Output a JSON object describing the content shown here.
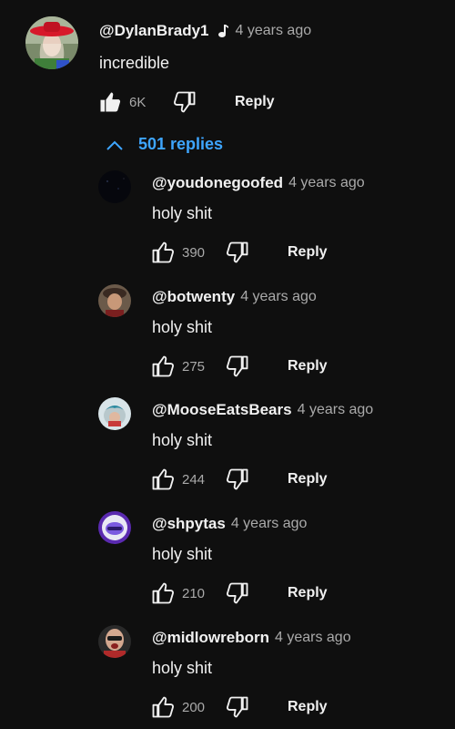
{
  "top_comment": {
    "author": "@DylanBrady1",
    "badge_icon": "music-note-icon",
    "time": "4 years ago",
    "text": "incredible",
    "like_count": "6K",
    "reply_label": "Reply"
  },
  "replies_toggle": {
    "icon": "chevron-up-icon",
    "label": "501 replies"
  },
  "replies": [
    {
      "author": "@youdonegoofed",
      "time": "4 years ago",
      "text": "holy shit",
      "like_count": "390",
      "reply_label": "Reply"
    },
    {
      "author": "@botwenty",
      "time": "4 years ago",
      "text": "holy shit",
      "like_count": "275",
      "reply_label": "Reply"
    },
    {
      "author": "@MooseEatsBears",
      "time": "4 years ago",
      "text": "holy shit",
      "like_count": "244",
      "reply_label": "Reply"
    },
    {
      "author": "@shpytas",
      "time": "4 years ago",
      "text": "holy shit",
      "like_count": "210",
      "reply_label": "Reply"
    },
    {
      "author": "@midlowreborn",
      "time": "4 years ago",
      "text": "holy shit",
      "like_count": "200",
      "reply_label": "Reply"
    }
  ],
  "colors": {
    "background": "#0f0f0f",
    "text_primary": "#f1f1f1",
    "text_secondary": "#aaaaaa",
    "link_blue": "#3ea6ff"
  }
}
